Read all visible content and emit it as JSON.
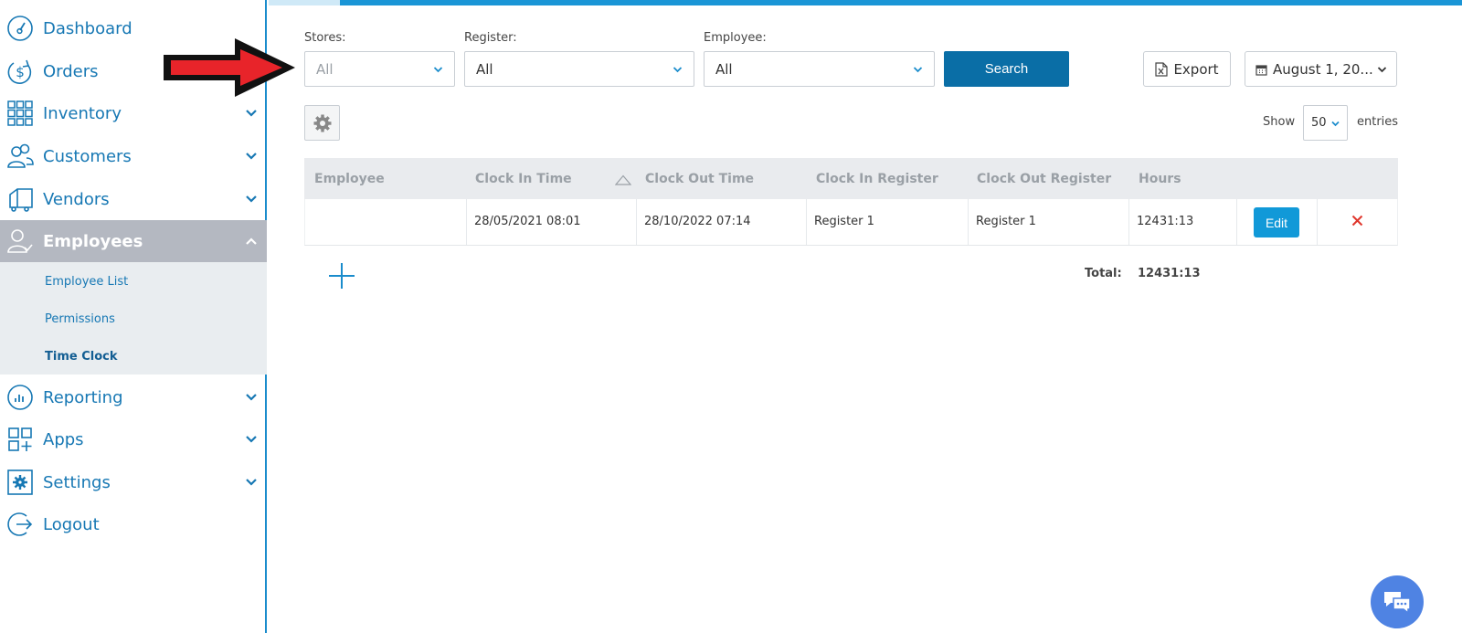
{
  "sidebar": {
    "items": [
      {
        "label": "Dashboard",
        "icon": "dashboard-icon"
      },
      {
        "label": "Orders",
        "icon": "orders-icon"
      },
      {
        "label": "Inventory",
        "icon": "inventory-icon"
      },
      {
        "label": "Customers",
        "icon": "customers-icon"
      },
      {
        "label": "Vendors",
        "icon": "vendors-icon"
      },
      {
        "label": "Employees",
        "icon": "employees-icon"
      },
      {
        "label": "Reporting",
        "icon": "reporting-icon"
      },
      {
        "label": "Apps",
        "icon": "apps-icon"
      },
      {
        "label": "Settings",
        "icon": "settings-icon"
      },
      {
        "label": "Logout",
        "icon": "logout-icon"
      }
    ],
    "employee_subitems": [
      "Employee List",
      "Permissions",
      "Time Clock"
    ]
  },
  "filters": {
    "stores_label": "Stores:",
    "stores_value": "All",
    "register_label": "Register:",
    "register_value": "All",
    "employee_label": "Employee:",
    "employee_value": "All",
    "search_label": "Search",
    "export_label": "Export",
    "date_value": "August 1, 20..."
  },
  "entries": {
    "show_label": "Show",
    "value": "50",
    "entries_label": "entries"
  },
  "table": {
    "headers": [
      "Employee",
      "Clock In Time",
      "Clock Out Time",
      "Clock In Register",
      "Clock Out Register",
      "Hours"
    ],
    "rows": [
      {
        "employee": "",
        "clock_in": "28/05/2021 08:01",
        "clock_out": "28/10/2022 07:14",
        "in_register": "Register 1",
        "out_register": "Register 1",
        "hours": "12431:13",
        "edit_label": "Edit"
      }
    ],
    "total_label": "Total:",
    "total_value": "12431:13"
  },
  "colors": {
    "accent": "#1778b4",
    "primary_button": "#0a6ea6",
    "edit_button": "#1199d8",
    "delete": "#e0362c",
    "active_nav": "#b4b8c1"
  }
}
